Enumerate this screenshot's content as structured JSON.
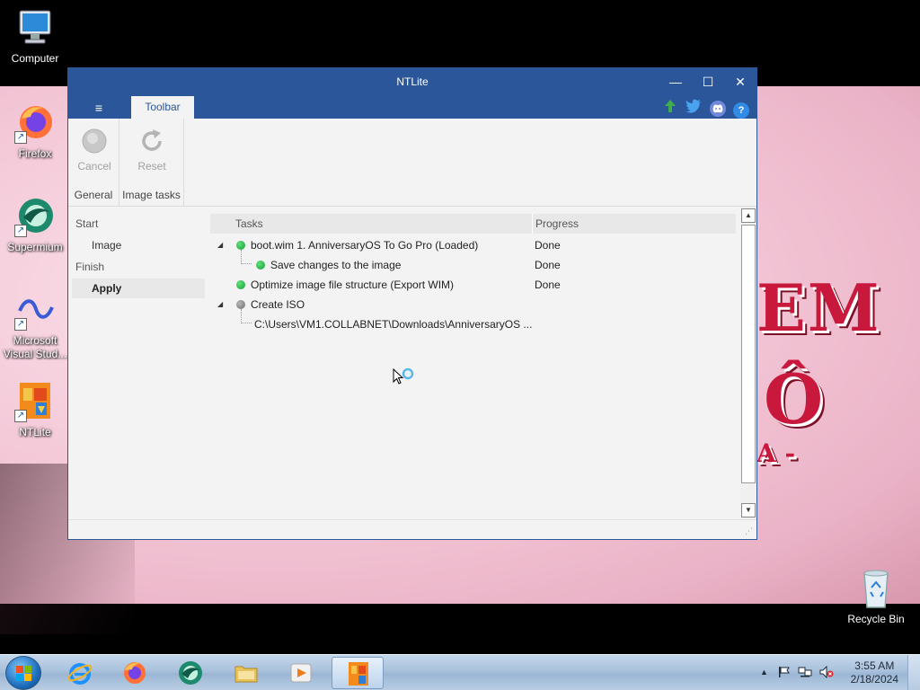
{
  "desktop": {
    "icons": [
      {
        "name": "computer",
        "label": "Computer"
      },
      {
        "name": "firefox",
        "label": "Firefox"
      },
      {
        "name": "supermium",
        "label": "Supermium"
      },
      {
        "name": "visual-studio",
        "label": "Microsoft Visual Stud..."
      },
      {
        "name": "ntlite",
        "label": "NTLite"
      },
      {
        "name": "recycle-bin",
        "label": "Recycle Bin"
      }
    ],
    "wallpaper_text": {
      "line1": "EM",
      "line2": "Ô",
      "line3": "A -"
    }
  },
  "window": {
    "title": "NTLite",
    "controls": {
      "minimize": "—",
      "maximize": "☐",
      "close": "✕"
    },
    "menu_icon": "≡",
    "tab_label": "Toolbar",
    "header_icons": [
      "update-icon",
      "twitter-icon",
      "discord-icon",
      "help-icon"
    ],
    "help_glyph": "?"
  },
  "ribbon": {
    "groups": [
      {
        "label": "General",
        "buttons": [
          {
            "label": "Cancel",
            "icon": "cancel-icon"
          }
        ]
      },
      {
        "label": "Image tasks",
        "buttons": [
          {
            "label": "Reset",
            "icon": "reset-icon"
          }
        ]
      }
    ]
  },
  "nav": {
    "start": "Start",
    "image": "Image",
    "finish": "Finish",
    "apply": "Apply"
  },
  "tasks": {
    "headers": {
      "tasks": "Tasks",
      "progress": "Progress"
    },
    "rows": [
      {
        "label": "boot.wim 1. AnniversaryOS To Go Pro  (Loaded)",
        "progress": "Done",
        "status": "green"
      },
      {
        "label": "Save changes to the image",
        "progress": "Done",
        "status": "green"
      },
      {
        "label": "Optimize image file structure (Export WIM)",
        "progress": "Done",
        "status": "green"
      },
      {
        "label": "Create ISO",
        "progress": "",
        "status": "gray"
      },
      {
        "label": "C:\\Users\\VM1.COLLABNET\\Downloads\\AnniversaryOS ...",
        "progress": ""
      }
    ]
  },
  "taskbar": {
    "apps": [
      "internet-explorer",
      "firefox",
      "supermium",
      "file-explorer",
      "media-player",
      "ntlite"
    ],
    "active_app": "ntlite",
    "clock": {
      "time": "3:55 AM",
      "date": "2/18/2024"
    }
  },
  "colors": {
    "accent": "#2b579a",
    "done_green": "#12a133",
    "pending_gray": "#6e6e6e"
  }
}
